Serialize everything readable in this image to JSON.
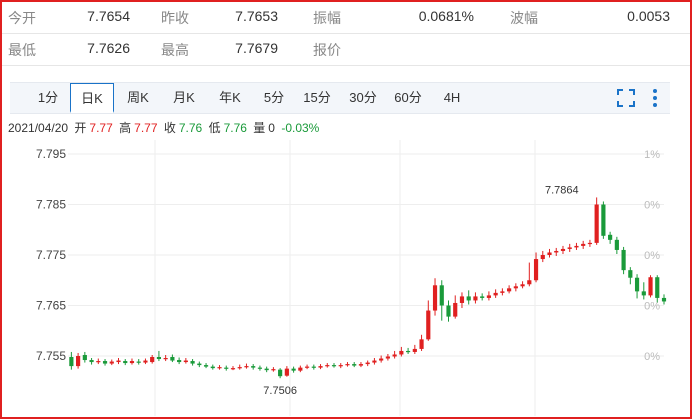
{
  "quotes": {
    "row1": [
      {
        "label": "今开",
        "value": "7.7654"
      },
      {
        "label": "昨收",
        "value": "7.7653"
      },
      {
        "label": "振幅",
        "value": "0.0681%"
      },
      {
        "label": "波幅",
        "value": "0.0053"
      }
    ],
    "row2": [
      {
        "label": "最低",
        "value": "7.7626"
      },
      {
        "label": "最高",
        "value": "7.7679"
      },
      {
        "label": "报价",
        "value": ""
      }
    ]
  },
  "tabs": [
    {
      "label": "1分"
    },
    {
      "label": "日K",
      "active": true
    },
    {
      "label": "周K"
    },
    {
      "label": "月K"
    },
    {
      "label": "年K"
    },
    {
      "label": "5分"
    },
    {
      "label": "15分"
    },
    {
      "label": "30分"
    },
    {
      "label": "60分"
    },
    {
      "label": "4H"
    }
  ],
  "toolbar_icons": [
    "fullscreen-icon",
    "more-vertical-icon"
  ],
  "ohlc": {
    "date": "2021/04/20",
    "open_label": "开",
    "open": "7.77",
    "high_label": "高",
    "high": "7.77",
    "close_label": "收",
    "close": "7.76",
    "low_label": "低",
    "low": "7.76",
    "volume_label": "量",
    "volume": "0",
    "change": "-0.03%"
  },
  "colors": {
    "up": "#e02020",
    "down": "#1a9a3a",
    "accent": "#1a73c8"
  },
  "chart_data": {
    "type": "candlestick",
    "y_ticks": [
      "7.795",
      "7.785",
      "7.775",
      "7.765",
      "7.755"
    ],
    "y_tick_values": [
      7.795,
      7.785,
      7.775,
      7.765,
      7.755
    ],
    "right_ticks": [
      "1%",
      "0%",
      "0%",
      "0%",
      "0%"
    ],
    "ylim": [
      7.75,
      7.795
    ],
    "grid": true,
    "annotations": [
      {
        "text": "7.7864",
        "type": "max"
      },
      {
        "text": "7.7506",
        "type": "min"
      }
    ],
    "candles": [
      [
        7.7548,
        7.753,
        7.7558,
        7.7523
      ],
      [
        7.753,
        7.755,
        7.7556,
        7.7525
      ],
      [
        7.7552,
        7.7542,
        7.7558,
        7.7537
      ],
      [
        7.7542,
        7.7538,
        7.7546,
        7.7533
      ],
      [
        7.7538,
        7.754,
        7.7545,
        7.7534
      ],
      [
        7.754,
        7.7535,
        7.7544,
        7.7531
      ],
      [
        7.7535,
        7.7539,
        7.7543,
        7.7532
      ],
      [
        7.7538,
        7.7541,
        7.7546,
        7.7534
      ],
      [
        7.754,
        7.7536,
        7.7544,
        7.7532
      ],
      [
        7.7536,
        7.754,
        7.7545,
        7.7533
      ],
      [
        7.7539,
        7.7537,
        7.7544,
        7.7533
      ],
      [
        7.7537,
        7.7541,
        7.7545,
        7.7534
      ],
      [
        7.7538,
        7.7548,
        7.7552,
        7.7535
      ],
      [
        7.7548,
        7.7544,
        7.756,
        7.754
      ],
      [
        7.7545,
        7.7546,
        7.7552,
        7.754
      ],
      [
        7.7548,
        7.7541,
        7.7553,
        7.7538
      ],
      [
        7.7542,
        7.7538,
        7.7547,
        7.7534
      ],
      [
        7.7538,
        7.7541,
        7.7546,
        7.7535
      ],
      [
        7.754,
        7.7535,
        7.7544,
        7.7531
      ],
      [
        7.7535,
        7.7532,
        7.7539,
        7.7528
      ],
      [
        7.7532,
        7.7529,
        7.7536,
        7.7526
      ],
      [
        7.7529,
        7.7526,
        7.7533,
        7.7523
      ],
      [
        7.7526,
        7.7528,
        7.7532,
        7.7523
      ],
      [
        7.7527,
        7.7525,
        7.7531,
        7.7521
      ],
      [
        7.7525,
        7.7526,
        7.753,
        7.7522
      ],
      [
        7.7526,
        7.7528,
        7.7533,
        7.7523
      ],
      [
        7.7528,
        7.753,
        7.7535,
        7.7525
      ],
      [
        7.753,
        7.7527,
        7.7534,
        7.7523
      ],
      [
        7.7527,
        7.7525,
        7.7531,
        7.7521
      ],
      [
        7.7525,
        7.7522,
        7.7529,
        7.7518
      ],
      [
        7.7522,
        7.7524,
        7.7528,
        7.7519
      ],
      [
        7.7523,
        7.751,
        7.7526,
        7.7506
      ],
      [
        7.7511,
        7.7525,
        7.753,
        7.7509
      ],
      [
        7.7525,
        7.7521,
        7.7529,
        7.7517
      ],
      [
        7.7521,
        7.7527,
        7.7531,
        7.7518
      ],
      [
        7.7527,
        7.7529,
        7.7533,
        7.7524
      ],
      [
        7.7529,
        7.7527,
        7.7533,
        7.7523
      ],
      [
        7.7527,
        7.753,
        7.7534,
        7.7524
      ],
      [
        7.753,
        7.7532,
        7.7536,
        7.7527
      ],
      [
        7.7532,
        7.753,
        7.7536,
        7.7527
      ],
      [
        7.753,
        7.7532,
        7.7536,
        7.7526
      ],
      [
        7.7532,
        7.7534,
        7.7538,
        7.7529
      ],
      [
        7.7534,
        7.7531,
        7.7538,
        7.7528
      ],
      [
        7.7531,
        7.7534,
        7.7538,
        7.7528
      ],
      [
        7.7534,
        7.7537,
        7.7541,
        7.753
      ],
      [
        7.7537,
        7.7541,
        7.7546,
        7.7533
      ],
      [
        7.7541,
        7.7545,
        7.7551,
        7.7537
      ],
      [
        7.7545,
        7.7549,
        7.7554,
        7.7541
      ],
      [
        7.7549,
        7.7553,
        7.756,
        7.7545
      ],
      [
        7.7553,
        7.756,
        7.7568,
        7.7549
      ],
      [
        7.756,
        7.7558,
        7.7566,
        7.7554
      ],
      [
        7.7558,
        7.7564,
        7.7572,
        7.7554
      ],
      [
        7.7564,
        7.7583,
        7.7592,
        7.756
      ],
      [
        7.7583,
        7.764,
        7.766,
        7.758
      ],
      [
        7.764,
        7.769,
        7.7704,
        7.763
      ],
      [
        7.769,
        7.765,
        7.77,
        7.762
      ],
      [
        7.765,
        7.7628,
        7.766,
        7.7618
      ],
      [
        7.7628,
        7.7655,
        7.767,
        7.7624
      ],
      [
        7.7655,
        7.7668,
        7.7676,
        7.7645
      ],
      [
        7.7668,
        7.766,
        7.768,
        7.7652
      ],
      [
        7.766,
        7.7668,
        7.7676,
        7.7654
      ],
      [
        7.7668,
        7.7665,
        7.7674,
        7.766
      ],
      [
        7.7665,
        7.767,
        7.7678,
        7.766
      ],
      [
        7.767,
        7.7675,
        7.7682,
        7.7665
      ],
      [
        7.7675,
        7.7678,
        7.7684,
        7.767
      ],
      [
        7.7678,
        7.7684,
        7.769,
        7.7674
      ],
      [
        7.7684,
        7.7688,
        7.7694,
        7.7678
      ],
      [
        7.7688,
        7.7692,
        7.7698,
        7.7684
      ],
      [
        7.7692,
        7.77,
        7.7735,
        7.7688
      ],
      [
        7.77,
        7.7742,
        7.7755,
        7.7696
      ],
      [
        7.7742,
        7.775,
        7.7758,
        7.7736
      ],
      [
        7.775,
        7.7755,
        7.7762,
        7.7745
      ],
      [
        7.7755,
        7.7758,
        7.7764,
        7.7748
      ],
      [
        7.7758,
        7.7762,
        7.7768,
        7.7752
      ],
      [
        7.7762,
        7.7765,
        7.7772,
        7.7756
      ],
      [
        7.7765,
        7.7768,
        7.7774,
        7.776
      ],
      [
        7.7768,
        7.7772,
        7.7778,
        7.7762
      ],
      [
        7.7772,
        7.7774,
        7.778,
        7.7766
      ],
      [
        7.7774,
        7.785,
        7.7864,
        7.777
      ],
      [
        7.785,
        7.7788,
        7.7856,
        7.7782
      ],
      [
        7.779,
        7.778,
        7.7796,
        7.7772
      ],
      [
        7.778,
        7.776,
        7.7786,
        7.7752
      ],
      [
        7.776,
        7.772,
        7.7766,
        7.7712
      ],
      [
        7.772,
        7.7705,
        7.7726,
        7.7692
      ],
      [
        7.7705,
        7.7678,
        7.7712,
        7.7664
      ],
      [
        7.7678,
        7.767,
        7.7696,
        7.7662
      ],
      [
        7.767,
        7.7706,
        7.771,
        7.7666
      ],
      [
        7.7706,
        7.7665,
        7.771,
        7.7656
      ],
      [
        7.7665,
        7.7658,
        7.7672,
        7.7652
      ]
    ]
  }
}
